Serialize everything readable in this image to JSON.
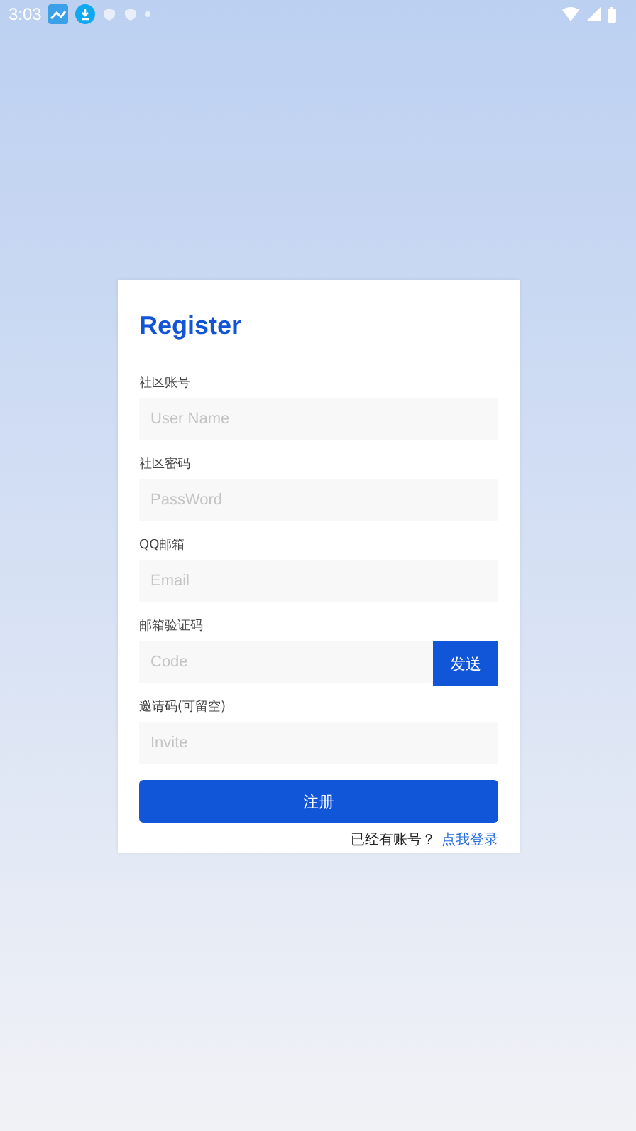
{
  "status_bar": {
    "time": "3:03"
  },
  "form": {
    "title": "Register",
    "fields": [
      {
        "kind": "text",
        "label": "社区账号",
        "placeholder": "User Name"
      },
      {
        "kind": "text",
        "label": "社区密码",
        "placeholder": "PassWord"
      },
      {
        "kind": "text",
        "label": "QQ邮箱",
        "placeholder": "Email"
      },
      {
        "kind": "code",
        "label": "邮箱验证码",
        "placeholder": "Code",
        "button": "发送"
      },
      {
        "kind": "text",
        "label": "邀请码(可留空)",
        "placeholder": "Invite"
      }
    ],
    "submit": "注册",
    "login_prompt": "已经有账号？",
    "login_link": "点我登录"
  }
}
